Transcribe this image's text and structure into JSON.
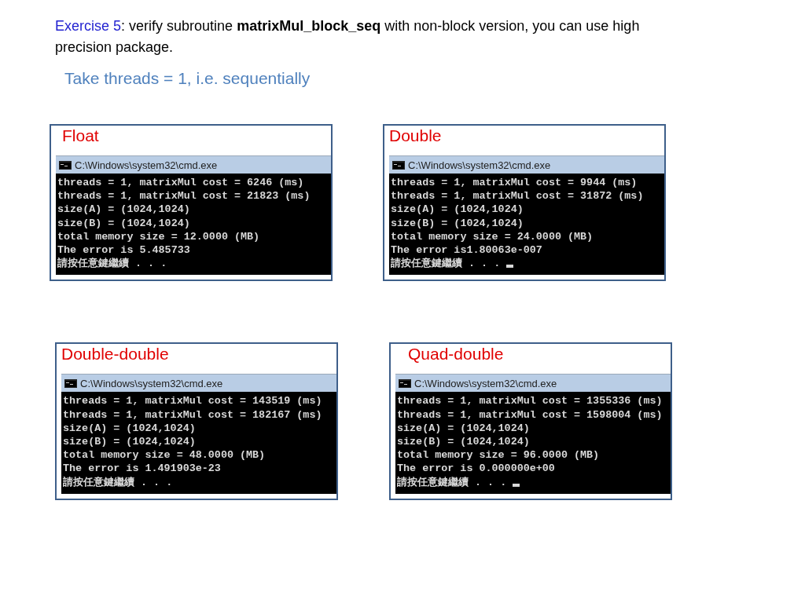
{
  "exercise": {
    "label": "Exercise 5",
    "text": ": verify subroutine **matrixMul_block_seq** with non-block version, you can use high precision package."
  },
  "subtitle": "Take threads = 1, i.e. sequentially",
  "panels": [
    {
      "title": "Float",
      "window_title": "C:\\Windows\\system32\\cmd.exe",
      "cursor": false,
      "lines": [
        "threads = 1, matrixMul cost = 6246 (ms)",
        "threads = 1, matrixMul cost = 21823 (ms)",
        "size(A) = (1024,1024)",
        "size(B) = (1024,1024)",
        "total memory size = 12.0000 (MB)",
        "The error is 5.485733",
        "請按任意鍵繼續 . . ."
      ]
    },
    {
      "title": "Double",
      "window_title": "C:\\Windows\\system32\\cmd.exe",
      "cursor": true,
      "lines": [
        "threads = 1, matrixMul cost = 9944 (ms)",
        "threads = 1, matrixMul cost = 31872 (ms)",
        "size(A) = (1024,1024)",
        "size(B) = (1024,1024)",
        "total memory size = 24.0000 (MB)",
        "The error is1.80063e-007",
        "請按任意鍵繼續 . . ."
      ]
    },
    {
      "title": "Double-double",
      "window_title": "C:\\Windows\\system32\\cmd.exe",
      "cursor": false,
      "lines": [
        "threads = 1, matrixMul cost = 143519 (ms)",
        "threads = 1, matrixMul cost = 182167 (ms)",
        "size(A) = (1024,1024)",
        "size(B) = (1024,1024)",
        "total memory size = 48.0000 (MB)",
        "The error is 1.491903e-23",
        "請按任意鍵繼續 . . ."
      ]
    },
    {
      "title": "Quad-double",
      "window_title": "C:\\Windows\\system32\\cmd.exe",
      "cursor": true,
      "lines": [
        "threads = 1, matrixMul cost = 1355336 (ms)",
        "threads = 1, matrixMul cost = 1598004 (ms)",
        "size(A) = (1024,1024)",
        "size(B) = (1024,1024)",
        "total memory size = 96.0000 (MB)",
        "The error is 0.000000e+00",
        "請按任意鍵繼續 . . ."
      ]
    }
  ]
}
